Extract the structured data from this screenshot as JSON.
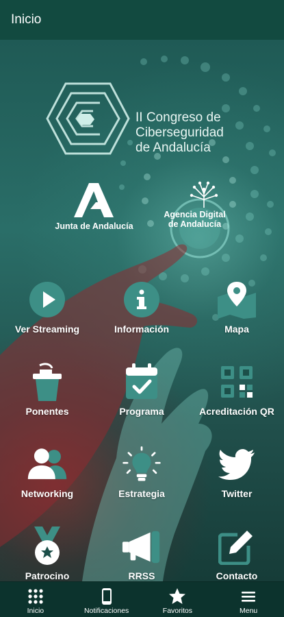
{
  "header": {
    "title": "Inicio"
  },
  "hero": {
    "title_lines": [
      "II Congreso de",
      "Ciberseguridad",
      "de Andalucía"
    ]
  },
  "logos": {
    "junta": "Junta de Andalucía",
    "agencia_line1": "Agencia Digital",
    "agencia_line2": "de Andalucía"
  },
  "menu": [
    {
      "label": "Ver Streaming",
      "icon": "play-icon"
    },
    {
      "label": "Información",
      "icon": "info-icon"
    },
    {
      "label": "Mapa",
      "icon": "map-icon"
    },
    {
      "label": "Ponentes",
      "icon": "podium-icon"
    },
    {
      "label": "Programa",
      "icon": "calendar-check-icon"
    },
    {
      "label": "Acreditación QR",
      "icon": "qr-code-icon"
    },
    {
      "label": "Networking",
      "icon": "users-icon"
    },
    {
      "label": "Estrategia",
      "icon": "lightbulb-icon"
    },
    {
      "label": "Twitter",
      "icon": "twitter-icon"
    },
    {
      "label": "Patrocino",
      "icon": "medal-icon"
    },
    {
      "label": "RRSS",
      "icon": "megaphone-icon"
    },
    {
      "label": "Contacto",
      "icon": "edit-icon"
    }
  ],
  "bottom_nav": [
    {
      "label": "Inicio",
      "icon": "grid-icon"
    },
    {
      "label": "Notificaciones",
      "icon": "phone-icon"
    },
    {
      "label": "Favoritos",
      "icon": "star-icon"
    },
    {
      "label": "Menu",
      "icon": "hamburger-icon"
    }
  ],
  "colors": {
    "topbar": "#124a40",
    "bottombar": "#0c332d",
    "icon_teal": "#3d8f86",
    "icon_light": "#ffffff"
  }
}
